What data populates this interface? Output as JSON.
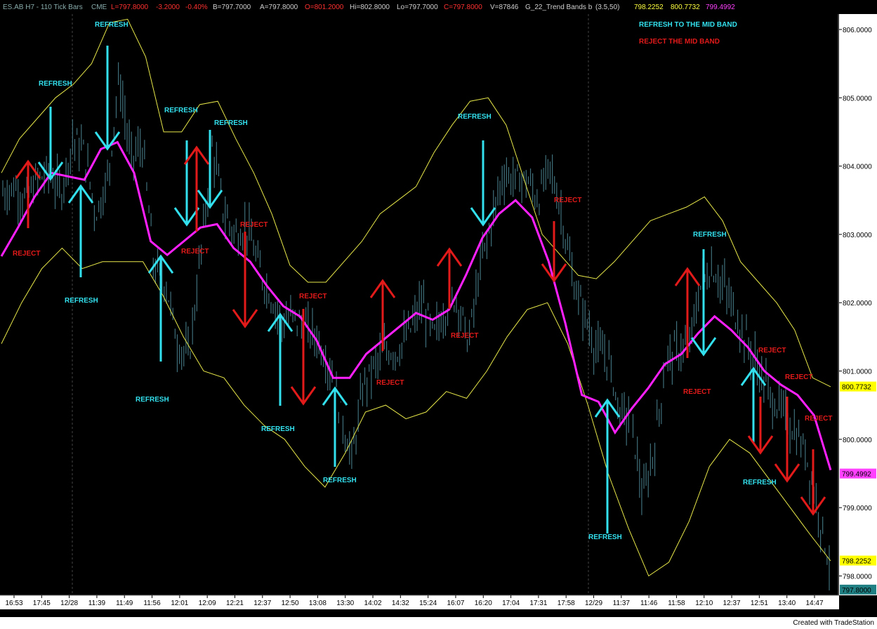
{
  "header": {
    "symbol": "ES.AB H7 - 110 Tick Bars",
    "exchange": "CME",
    "last": "L=797.8000",
    "change": "-3.2000",
    "pct": "-0.40%",
    "bid": "B=797.7000",
    "ask": "A=797.8000",
    "open": "O=801.2000",
    "high": "Hi=802.8000",
    "low": "Lo=797.7000",
    "close": "C=797.8000",
    "volume": "V=87846",
    "study": "G_22_Trend Bands b",
    "params": "(3.5,50)",
    "v1": "798.2252",
    "v2": "800.7732",
    "v3": "799.4992"
  },
  "legend": {
    "refresh": "REFRESH TO THE MID BAND",
    "reject": "REJECT THE MID BAND"
  },
  "footer": "Created with TradeStation",
  "colors": {
    "bg": "#000000",
    "bars": "#3f6f7a",
    "mid": "#ff20ff",
    "band": "#e8e84a",
    "refresh": "#33e0ee",
    "reject": "#e31a1a",
    "axisbg": "#ffffff"
  },
  "chart_data": {
    "type": "line",
    "ylim": [
      797.8,
      806.3
    ],
    "yticks": [
      "806.0000",
      "805.0000",
      "804.0000",
      "803.0000",
      "802.0000",
      "801.0000",
      "800.0000",
      "799.0000",
      "798.0000"
    ],
    "ytick_values": [
      806,
      805,
      804,
      803,
      802,
      801,
      800,
      799,
      798
    ],
    "price_tags": [
      {
        "label": "800.7732",
        "value": 800.773,
        "color": "#ffff00"
      },
      {
        "label": "799.4992",
        "value": 799.499,
        "color": "#ff40ff"
      },
      {
        "label": "798.2252",
        "value": 798.225,
        "color": "#ffff00"
      },
      {
        "label": "797.8000",
        "value": 797.8,
        "color": "#1f7f82"
      }
    ],
    "xticks": [
      "16:53",
      "17:45",
      "12/28",
      "11:39",
      "11:49",
      "11:56",
      "12:01",
      "12:09",
      "12:21",
      "12:37",
      "12:50",
      "13:08",
      "13:30",
      "14:02",
      "14:32",
      "15:24",
      "16:07",
      "16:20",
      "17:04",
      "17:31",
      "17:58",
      "12/29",
      "11:37",
      "11:46",
      "11:58",
      "12:10",
      "12:37",
      "12:51",
      "13:40",
      "14:47"
    ],
    "bars_close": [
      803.6,
      803.7,
      803.5,
      803.8,
      803.9,
      803.6,
      804.4,
      804.2,
      803.3,
      803.8,
      805.3,
      804.1,
      804.3,
      802.5,
      802.3,
      801.4,
      801.2,
      802.7,
      804.3,
      803.3,
      803.0,
      803.1,
      802.5,
      802.1,
      801.7,
      801.8,
      801.6,
      801.5,
      801.1,
      800.4,
      799.7,
      800.8,
      801.1,
      801.3,
      801.3,
      801.6,
      802.0,
      801.5,
      801.9,
      802.1,
      801.4,
      802.5,
      803.2,
      803.9,
      803.8,
      803.8,
      803.5,
      804.0,
      803.3,
      802.3,
      801.8,
      801.3,
      801.2,
      800.4,
      800.3,
      799.1,
      799.9,
      801.2,
      801.3,
      801.4,
      802.3,
      802.5,
      802.2,
      801.8,
      801.4,
      801.0,
      800.6,
      800.4,
      800.1,
      799.8,
      799.0,
      798.2
    ],
    "mid_band": [
      802.68,
      803.1,
      803.55,
      803.9,
      803.85,
      803.8,
      804.25,
      804.35,
      803.9,
      802.9,
      802.7,
      802.9,
      803.1,
      803.15,
      802.8,
      802.6,
      802.25,
      801.95,
      801.8,
      801.45,
      800.9,
      800.9,
      801.25,
      801.45,
      801.65,
      801.85,
      801.75,
      801.9,
      802.4,
      802.95,
      803.3,
      803.5,
      803.25,
      802.6,
      801.7,
      800.65,
      800.55,
      800.1,
      800.45,
      800.75,
      801.1,
      801.25,
      801.55,
      801.8,
      801.6,
      801.35,
      801.0,
      800.8,
      800.65,
      800.35,
      799.55
    ],
    "upper_band": [
      803.9,
      804.4,
      804.7,
      805.0,
      805.2,
      805.5,
      806.1,
      806.15,
      805.6,
      804.5,
      804.5,
      804.9,
      804.95,
      804.4,
      803.9,
      803.3,
      802.55,
      802.3,
      802.3,
      802.6,
      802.9,
      803.3,
      803.5,
      803.7,
      804.2,
      804.6,
      804.95,
      805.0,
      804.6,
      803.8,
      803.0,
      802.7,
      802.4,
      802.35,
      802.6,
      802.9,
      803.2,
      803.3,
      803.4,
      803.55,
      803.2,
      802.6,
      802.3,
      802.0,
      801.6,
      800.9,
      800.77
    ],
    "lower_band": [
      801.4,
      802.0,
      802.5,
      802.8,
      802.5,
      802.6,
      802.6,
      802.6,
      802.1,
      801.5,
      801.0,
      800.9,
      800.5,
      800.2,
      800.0,
      799.6,
      799.3,
      799.8,
      800.4,
      800.5,
      800.3,
      800.4,
      800.7,
      800.6,
      801.0,
      801.5,
      801.9,
      802.0,
      801.4,
      800.5,
      799.5,
      798.7,
      798.0,
      798.2,
      798.8,
      799.6,
      800.0,
      799.8,
      799.4,
      799.0,
      798.6,
      798.22
    ],
    "annotations": [
      {
        "text": "REFRESH",
        "kind": "refresh"
      },
      {
        "text": "REFRESH",
        "kind": "refresh"
      },
      {
        "text": "REFRESH",
        "kind": "refresh"
      },
      {
        "text": "REFRESH",
        "kind": "refresh"
      },
      {
        "text": "REFRESH",
        "kind": "refresh"
      },
      {
        "text": "REFRESH",
        "kind": "refresh"
      },
      {
        "text": "REFRESH",
        "kind": "refresh"
      },
      {
        "text": "REFRESH",
        "kind": "refresh"
      },
      {
        "text": "REFRESH",
        "kind": "refresh"
      },
      {
        "text": "REFRESH",
        "kind": "refresh"
      },
      {
        "text": "REFRESH",
        "kind": "refresh"
      },
      {
        "text": "REFRESH",
        "kind": "refresh"
      },
      {
        "text": "REJECT",
        "kind": "reject"
      },
      {
        "text": "REJECT",
        "kind": "reject"
      },
      {
        "text": "REJECT",
        "kind": "reject"
      },
      {
        "text": "REJECT",
        "kind": "reject"
      },
      {
        "text": "REJECT",
        "kind": "reject"
      },
      {
        "text": "REJECT",
        "kind": "reject"
      },
      {
        "text": "REJECT",
        "kind": "reject"
      },
      {
        "text": "REJECT",
        "kind": "reject"
      },
      {
        "text": "REJECT",
        "kind": "reject"
      },
      {
        "text": "REJECT",
        "kind": "reject"
      },
      {
        "text": "REJECT",
        "kind": "reject"
      },
      {
        "text": "REJECT",
        "kind": "reject"
      }
    ]
  }
}
